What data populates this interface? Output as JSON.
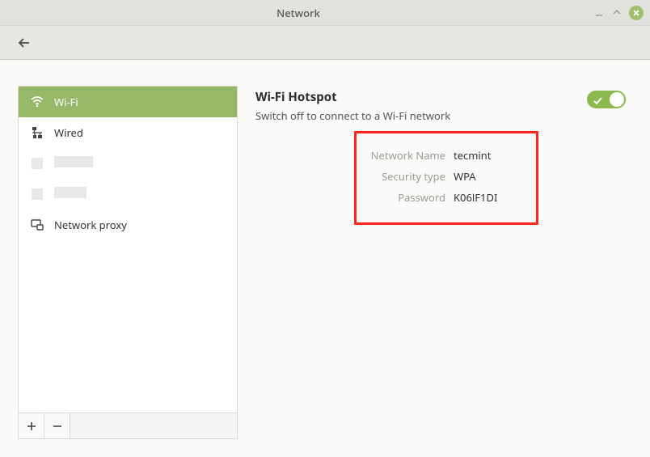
{
  "window": {
    "title": "Network"
  },
  "sidebar": {
    "items": [
      {
        "label": "Wi-Fi"
      },
      {
        "label": "Wired"
      },
      {
        "label": ""
      },
      {
        "label": ""
      },
      {
        "label": "Network proxy"
      }
    ]
  },
  "main": {
    "title": "Wi-Fi Hotspot",
    "subtitle": "Switch off to connect to a Wi-Fi network",
    "details": {
      "network_name_label": "Network Name",
      "network_name_value": "tecmint",
      "security_type_label": "Security type",
      "security_type_value": "WPA",
      "password_label": "Password",
      "password_value": "K06lF1DI"
    }
  }
}
